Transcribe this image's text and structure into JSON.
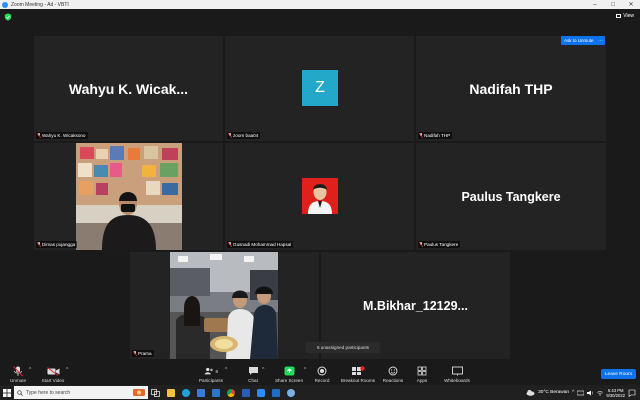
{
  "window": {
    "title": "Zoom Meeting - Ad - VBTI"
  },
  "top": {
    "view_label": "View"
  },
  "tiles": [
    {
      "id": "wahyu",
      "big_name": "Wahyu  K.  Wicak...",
      "label": "Wahyu K. Wicaksono"
    },
    {
      "id": "zoom",
      "avatar_letter": "Z",
      "label": "zoom baa04"
    },
    {
      "id": "nadifah",
      "big_name": "Nadifah THP",
      "label": "Nadifah THP"
    },
    {
      "id": "dimas",
      "label": "Dimas pujangga"
    },
    {
      "id": "gusnadi",
      "label": "Gusnadi Mohammad Hapsal"
    },
    {
      "id": "paulus",
      "big_name": "Paulus Tangkere",
      "label": "Paulus Tangkere"
    },
    {
      "id": "prama",
      "label": "Prama"
    },
    {
      "id": "bikhar",
      "big_name": "M.Bikhar_12129..."
    }
  ],
  "ask_unmute": {
    "label": "Ask to Unmute",
    "more": "⋯"
  },
  "unassigned": "6 unassigned participants",
  "toolbar": {
    "unmute": "Unmute",
    "start_video": "Start Video",
    "participants": "Participants",
    "participants_count": "8",
    "chat": "Chat",
    "share_screen": "Share Screen",
    "record": "Record",
    "breakout_rooms": "Breakout Rooms",
    "reactions": "Reactions",
    "apps": "Apps",
    "whiteboards": "Whiteboards",
    "leave": "Leave Room"
  },
  "taskbar": {
    "search_placeholder": "Type here to search",
    "weather": "30°C  Berawan",
    "time": "6:43 PM",
    "date": "9/30/2022"
  },
  "colors": {
    "accent": "#0e72ed",
    "tile_bg": "#232323",
    "share_green": "#23d959",
    "avatar_teal": "#23a8c9"
  }
}
